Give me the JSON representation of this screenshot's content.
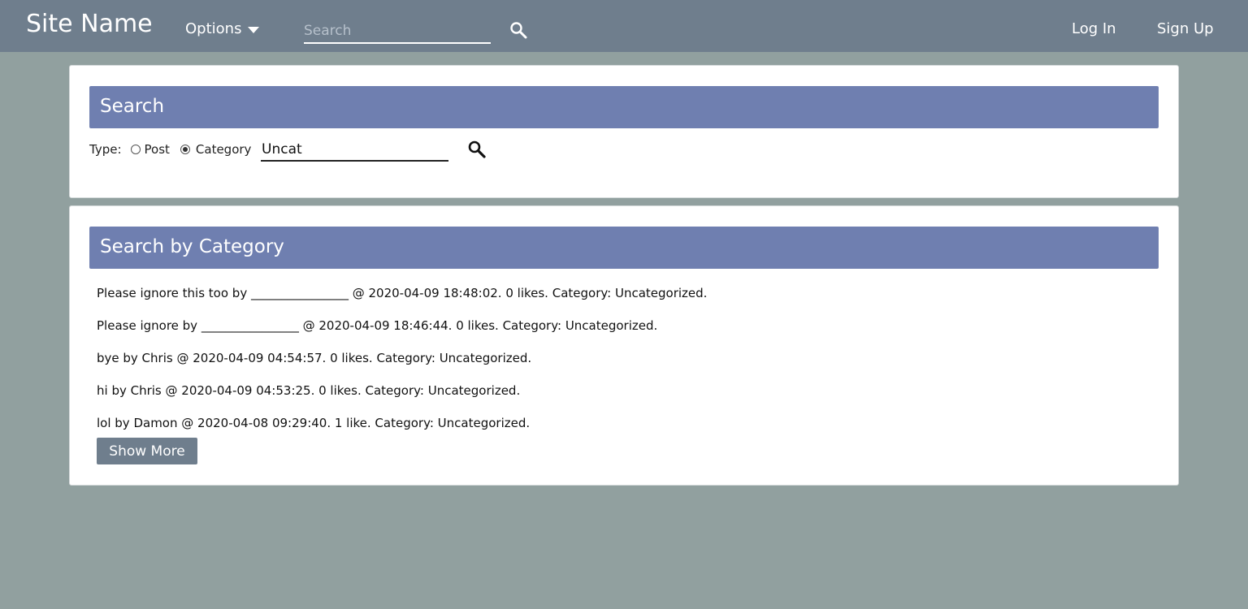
{
  "navbar": {
    "site_name": "Site Name",
    "options_label": "Options",
    "search_placeholder": "Search",
    "login_label": "Log In",
    "signup_label": "Sign Up",
    "search_icon": "search-icon",
    "caret_icon": "chevron-down-icon"
  },
  "search_panel": {
    "title": "Search",
    "type_label": "Type:",
    "options": [
      {
        "label": "Post",
        "selected": false
      },
      {
        "label": "Category",
        "selected": true
      }
    ],
    "query_value": "Uncat",
    "search_icon": "search-icon"
  },
  "results_panel": {
    "title": "Search by Category",
    "items": [
      "Please ignore this too by ________________ @ 2020-04-09 18:48:02. 0 likes. Category: Uncategorized.",
      "Please ignore by ________________ @ 2020-04-09 18:46:44. 0 likes. Category: Uncategorized.",
      "bye by Chris @ 2020-04-09 04:54:57. 0 likes. Category: Uncategorized.",
      "hi by Chris @ 2020-04-09 04:53:25. 0 likes. Category: Uncategorized.",
      "lol by Damon @ 2020-04-08 09:29:40. 1 like. Category: Uncategorized."
    ],
    "show_more_label": "Show More"
  },
  "colors": {
    "navbar": "#6f7e8d",
    "page_background": "#91a09f",
    "panel_header": "#6f7fb0",
    "button": "#6f7e8d"
  }
}
